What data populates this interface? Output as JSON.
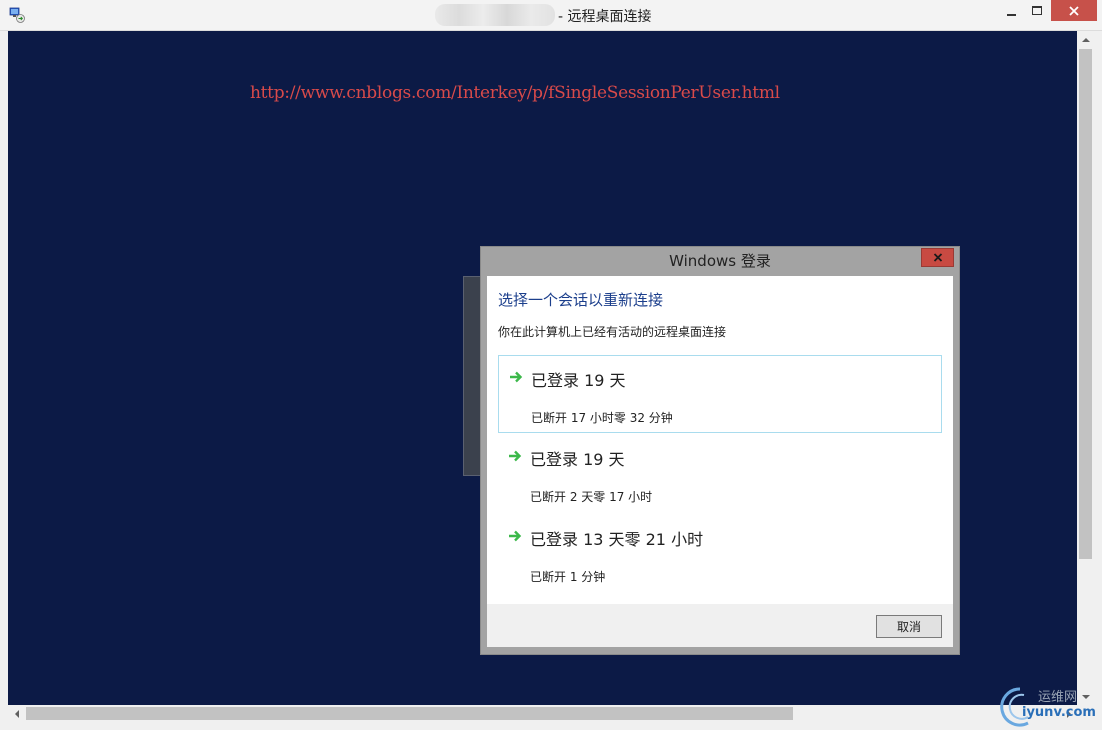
{
  "window": {
    "title": "- 远程桌面连接",
    "minimize_icon": "minimize-icon",
    "maximize_icon": "maximize-icon",
    "close_icon": "close-icon"
  },
  "desktop": {
    "url": "http://www.cnblogs.com/Interkey/p/fSingleSessionPerUser.html",
    "background_color": "#0c1a46"
  },
  "dialog": {
    "title": "Windows 登录",
    "heading": "选择一个会话以重新连接",
    "description": "你在此计算机上已经有活动的远程桌面连接",
    "sessions": [
      {
        "title": "已登录 19 天",
        "status": "已断开 17 小时零 32 分钟",
        "selected": true,
        "icon": "arrow-right-icon"
      },
      {
        "title": "已登录 19 天",
        "status": "已断开 2 天零 17 小时",
        "selected": false,
        "icon": "arrow-right-icon"
      },
      {
        "title": "已登录 13 天零 21 小时",
        "status": "已断开 1 分钟",
        "selected": false,
        "icon": "arrow-right-icon"
      }
    ],
    "cancel_label": "取消",
    "accent_color": "#1c3f8c",
    "arrow_color": "#3cb84a"
  },
  "watermark": {
    "top": "运维网",
    "bottom": "iyunv.com"
  }
}
